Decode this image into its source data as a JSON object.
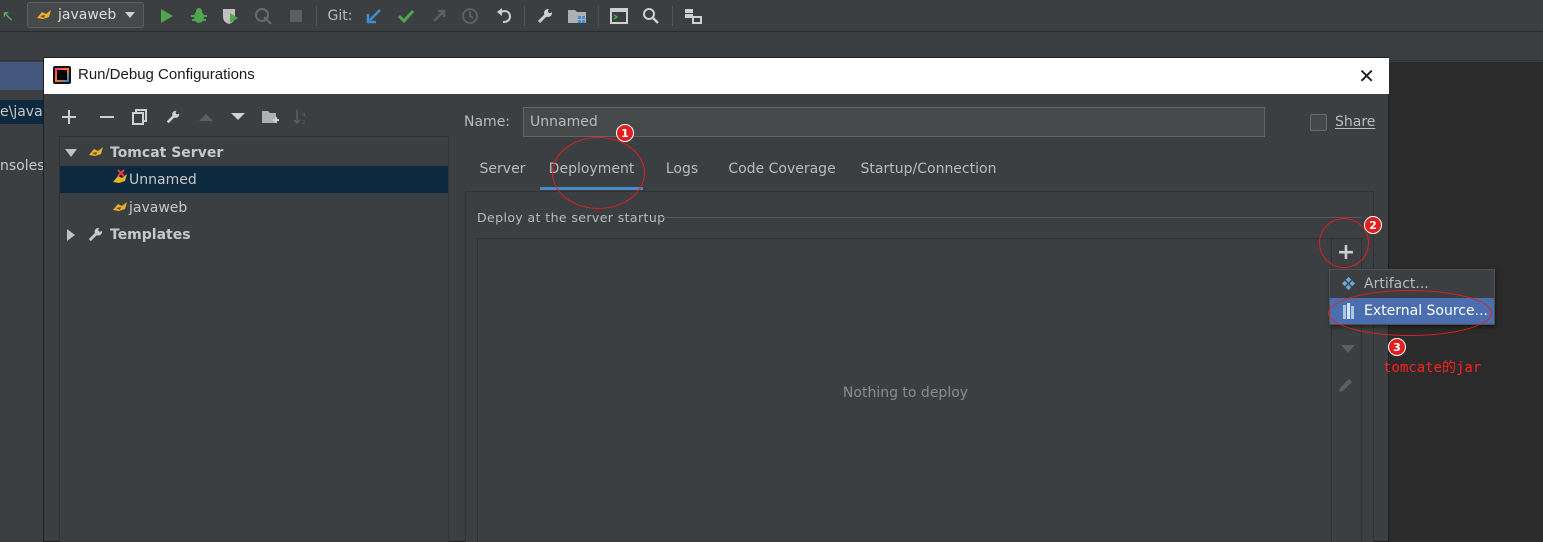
{
  "toolbar": {
    "run_config": "javaweb",
    "git_label": "Git:"
  },
  "background": {
    "path_fragment": "e\\javav",
    "consoles_fragment": "nsoles"
  },
  "dialog": {
    "title": "Run/Debug Configurations",
    "close": "✕"
  },
  "tree": {
    "root": "Tomcat Server",
    "items": [
      "Unnamed",
      "javaweb"
    ],
    "templates": "Templates"
  },
  "form": {
    "name_label": "Name:",
    "name_value": "Unnamed",
    "share_label": "Share"
  },
  "tabs": [
    "Server",
    "Deployment",
    "Logs",
    "Code Coverage",
    "Startup/Connection"
  ],
  "active_tab": "Deployment",
  "deployment": {
    "section_title": "Deploy at the server startup",
    "empty_text": "Nothing to deploy"
  },
  "menu": {
    "items": [
      "Artifact...",
      "External Source..."
    ],
    "highlighted": "External Source..."
  },
  "annotations": {
    "badges": [
      "1",
      "2",
      "3"
    ],
    "note": "tomcate的jar",
    "color": "#e02020"
  },
  "colors": {
    "accent": "#4a88c7",
    "selection": "#0d293e",
    "menu_highlight": "#4b6eaf",
    "panel": "#3c3f41"
  }
}
